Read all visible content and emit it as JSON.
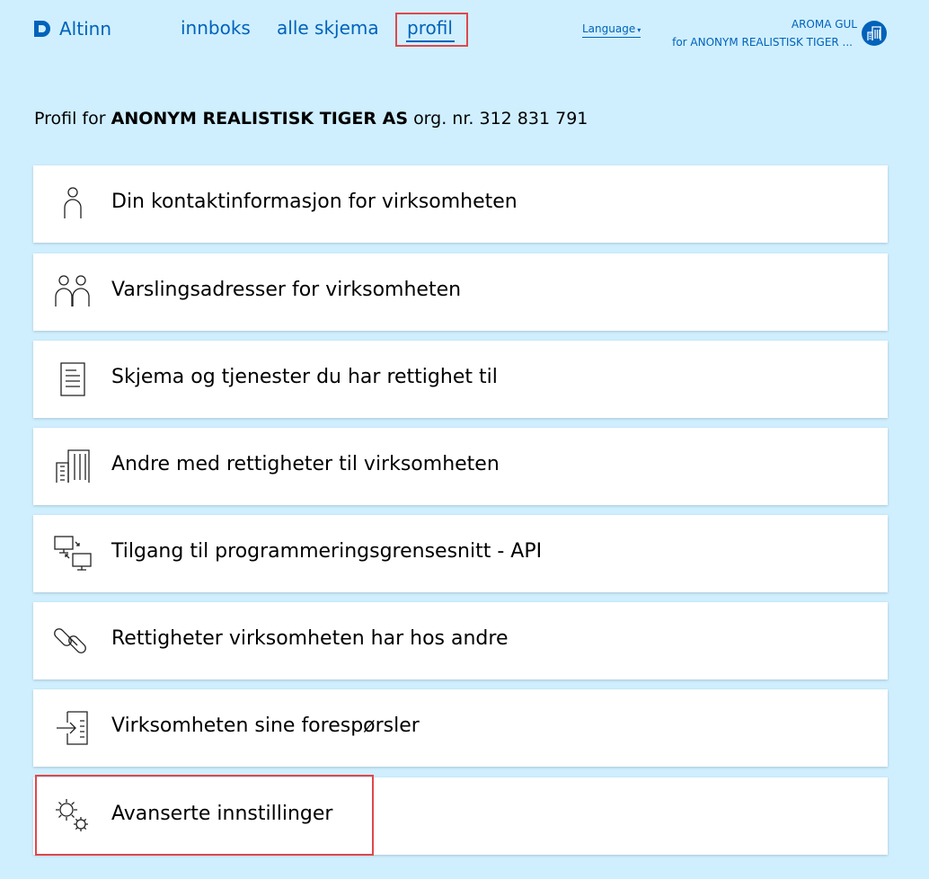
{
  "header": {
    "logo_text": "Altinn",
    "nav": [
      {
        "label": "innboks"
      },
      {
        "label": "alle skjema"
      },
      {
        "label": "profil",
        "active": true
      }
    ],
    "language_label": "Language",
    "user_name": "AROMA GUL",
    "user_org": "for ANONYM REALISTISK TIGER ..."
  },
  "page": {
    "title_prefix": "Profil for",
    "org_name": "ANONYM REALISTISK TIGER AS",
    "org_suffix": "org. nr. 312 831 791"
  },
  "cards": [
    {
      "label": "Din kontaktinformasjon for virksomheten",
      "icon": "person-icon"
    },
    {
      "label": "Varslingsadresser for virksomheten",
      "icon": "people-icon"
    },
    {
      "label": "Skjema og tjenester du har rettighet til",
      "icon": "document-icon"
    },
    {
      "label": "Andre med rettigheter til virksomheten",
      "icon": "buildings-icon"
    },
    {
      "label": "Tilgang til programmeringsgrensesnitt - API",
      "icon": "computers-icon"
    },
    {
      "label": "Rettigheter virksomheten har hos andre",
      "icon": "link-icon"
    },
    {
      "label": "Virksomheten sine forespørsler",
      "icon": "inbox-arrow-icon"
    },
    {
      "label": "Avanserte innstillinger",
      "icon": "gears-icon"
    }
  ],
  "colors": {
    "background": "#cfefff",
    "brand": "#0062ba",
    "highlight": "#e0474c"
  }
}
